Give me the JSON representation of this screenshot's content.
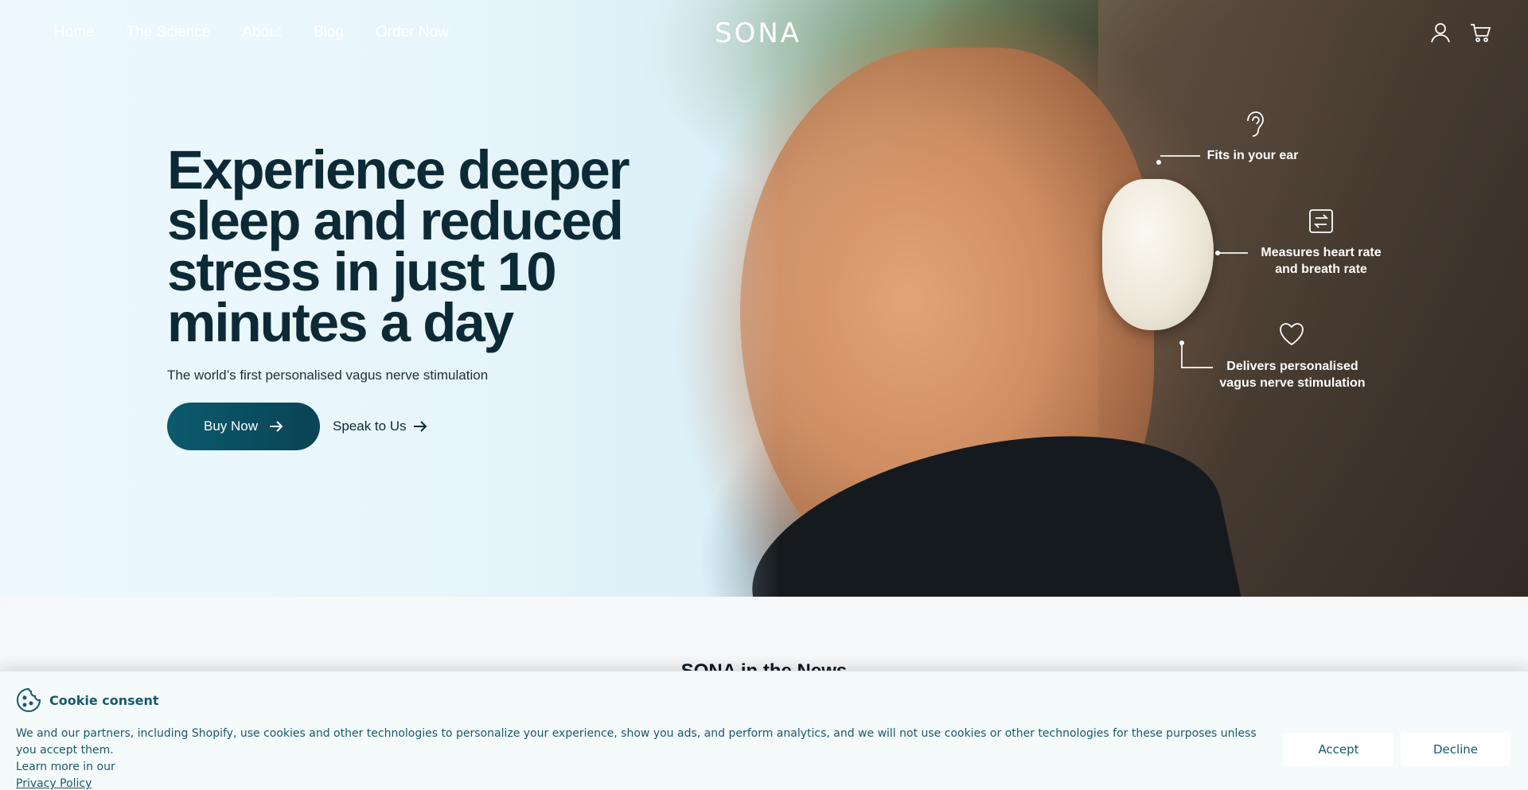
{
  "nav": {
    "links": [
      "Home",
      "The Science",
      "About",
      "Blog",
      "Order Now"
    ],
    "logo": "SONA"
  },
  "icons": {
    "account": "user-icon",
    "cart": "cart-icon",
    "ear": "ear-icon",
    "sync": "arrows-exchange-icon",
    "heart": "heart-icon",
    "cookie": "cookie-icon"
  },
  "hero": {
    "headline_lines": [
      "Experience deeper",
      "sleep and reduced",
      "stress in just 10",
      "minutes a day"
    ],
    "subline": "The world’s first personalised vagus nerve stimulation",
    "buy_label": "Buy Now",
    "speak_label": "Speak to Us",
    "features": {
      "ear": "Fits in your ear",
      "measure_1": "Measures heart rate",
      "measure_2": "and breath rate",
      "deliver_1": "Delivers personalised",
      "deliver_2": "vagus nerve stimulation"
    }
  },
  "news": {
    "title": "SONA in the News"
  },
  "cookie": {
    "title": "Cookie consent",
    "text": "We and our partners, including Shopify, use cookies and other technologies to personalize your experience, show you ads, and perform analytics, and we will not use cookies or other technologies for these purposes unless you accept them.",
    "learn_more": "Learn more in our",
    "privacy_link": "Privacy Policy",
    "accept_label": "Accept",
    "decline_label": "Decline"
  },
  "colors": {
    "brand_dark": "#0c2a36",
    "button": "#0b5a6e",
    "cookie_text": "#165a6b"
  }
}
